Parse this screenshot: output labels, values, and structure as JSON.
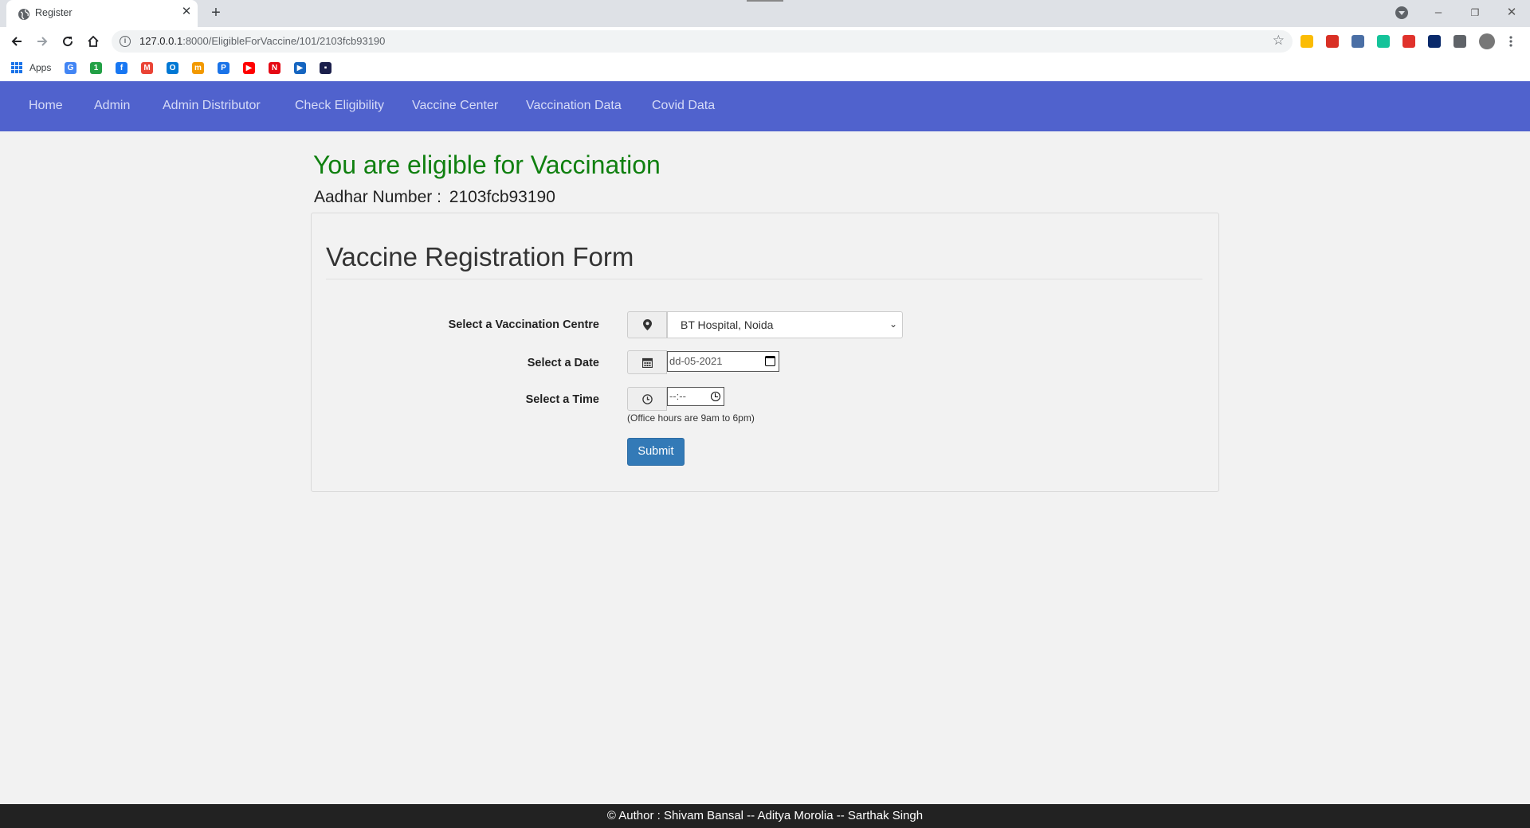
{
  "browser": {
    "tab_title": "Register",
    "new_tab_symbol": "+",
    "url_host": "127.0.0.1",
    "url_path": ":8000/EligibleForVaccine/101/2103fcb93190",
    "bookmarks_apps_label": "Apps",
    "window_controls": {
      "minimize": "–",
      "restore": "❐",
      "close": "✕"
    },
    "extension_icons": [
      {
        "name": "tricolor-extension-icon",
        "color": "#fbbc04"
      },
      {
        "name": "ad-block-extension-icon",
        "color": "#d93025"
      },
      {
        "name": "blue-circle-extension-icon",
        "color": "#4a6fa5"
      },
      {
        "name": "grammarly-extension-icon",
        "color": "#15c39a"
      },
      {
        "name": "tp-extension-icon",
        "color": "#e0322c"
      },
      {
        "name": "hp-extension-icon",
        "color": "#0a2a6b"
      },
      {
        "name": "puzzle-extensions-icon",
        "color": "#5f6368"
      },
      {
        "name": "profile-avatar-icon",
        "color": "#777777"
      }
    ],
    "bookmark_icons": [
      {
        "name": "google-bookmark-icon",
        "color": "#4285f4",
        "glyph": "G"
      },
      {
        "name": "green-bookmark-icon",
        "color": "#22a045",
        "glyph": "1"
      },
      {
        "name": "facebook-bookmark-icon",
        "color": "#1877f2",
        "glyph": "f"
      },
      {
        "name": "gmail-bookmark-icon",
        "color": "#ea4335",
        "glyph": "M"
      },
      {
        "name": "outlook-bookmark-icon",
        "color": "#0078d4",
        "glyph": "O"
      },
      {
        "name": "mn-bookmark-icon",
        "color": "#f29900",
        "glyph": "m"
      },
      {
        "name": "blue-p-bookmark-icon",
        "color": "#1a73e8",
        "glyph": "P"
      },
      {
        "name": "youtube-bookmark-icon",
        "color": "#ff0000",
        "glyph": "▶"
      },
      {
        "name": "netflix-bookmark-icon",
        "color": "#e50914",
        "glyph": "N"
      },
      {
        "name": "play-circle-bookmark-icon",
        "color": "#1565c0",
        "glyph": "▶"
      },
      {
        "name": "dark-square-bookmark-icon",
        "color": "#1b1f4b",
        "glyph": "▪"
      }
    ]
  },
  "navbar": {
    "items": [
      "Home",
      "Admin",
      "Admin Distributor",
      "Check Eligibility",
      "Vaccine Center",
      "Vaccination Data",
      "Covid Data"
    ],
    "background": "#5062cd"
  },
  "status": {
    "heading": "You are eligible for Vaccination",
    "aadhar_label": "Aadhar Number :",
    "aadhar_value": "2103fcb93190",
    "heading_color": "#108010"
  },
  "form": {
    "title": "Vaccine Registration Form",
    "centre_label": "Select a Vaccination Centre",
    "centre_value": "BT Hospital, Noida",
    "date_label": "Select a Date",
    "date_value": "dd-05-2021",
    "time_label": "Select a Time",
    "time_value": "--:--",
    "hint": "(Office hours are 9am to 6pm)",
    "submit_label": "Submit",
    "submit_color": "#337ab7"
  },
  "footer": {
    "text": "© Author : Shivam Bansal -- Aditya Morolia -- Sarthak Singh"
  }
}
